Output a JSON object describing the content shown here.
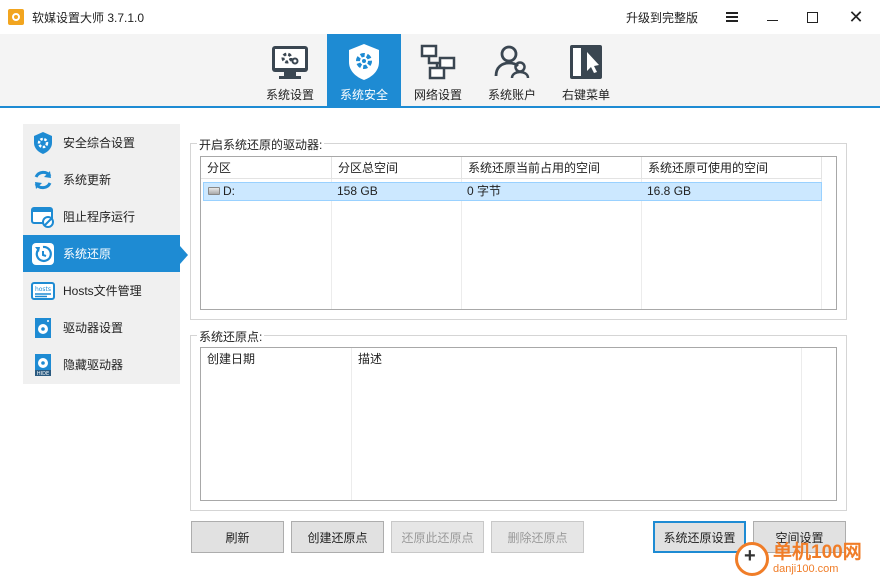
{
  "window": {
    "title": "软媒设置大师 3.7.1.0",
    "upgrade_label": "升级到完整版"
  },
  "tabs": [
    {
      "label": "系统设置",
      "icon": "monitor-gear-icon"
    },
    {
      "label": "系统安全",
      "icon": "shield-gear-icon",
      "active": true
    },
    {
      "label": "网络设置",
      "icon": "network-icon"
    },
    {
      "label": "系统账户",
      "icon": "users-icon"
    },
    {
      "label": "右键菜单",
      "icon": "cursor-menu-icon"
    }
  ],
  "sidebar": {
    "items": [
      {
        "label": "安全综合设置",
        "icon": "shield-icon"
      },
      {
        "label": "系统更新",
        "icon": "refresh-icon"
      },
      {
        "label": "阻止程序运行",
        "icon": "block-window-icon"
      },
      {
        "label": "系统还原",
        "icon": "restore-icon",
        "active": true
      },
      {
        "label": "Hosts文件管理",
        "icon": "hosts-file-icon"
      },
      {
        "label": "驱动器设置",
        "icon": "drive-icon"
      },
      {
        "label": "隐藏驱动器",
        "icon": "hide-drive-icon"
      }
    ]
  },
  "drives_group": {
    "title": "开启系统还原的驱动器:",
    "columns": [
      "分区",
      "分区总空间",
      "系统还原当前占用的空间",
      "系统还原可使用的空间"
    ],
    "rows": [
      {
        "partition": "D:",
        "total": "158 GB",
        "used": "0 字节",
        "available": "16.8 GB"
      }
    ]
  },
  "points_group": {
    "title": "系统还原点:",
    "columns": [
      "创建日期",
      "描述"
    ]
  },
  "buttons": {
    "refresh": "刷新",
    "create_point": "创建还原点",
    "restore_point": "还原此还原点",
    "delete_point": "删除还原点",
    "restore_settings": "系统还原设置",
    "space_settings": "空间设置"
  },
  "watermark": {
    "cn": "单机100网",
    "en": "danji100.com"
  },
  "colors": {
    "accent": "#1e8bd3",
    "watermark": "#f07d28"
  }
}
